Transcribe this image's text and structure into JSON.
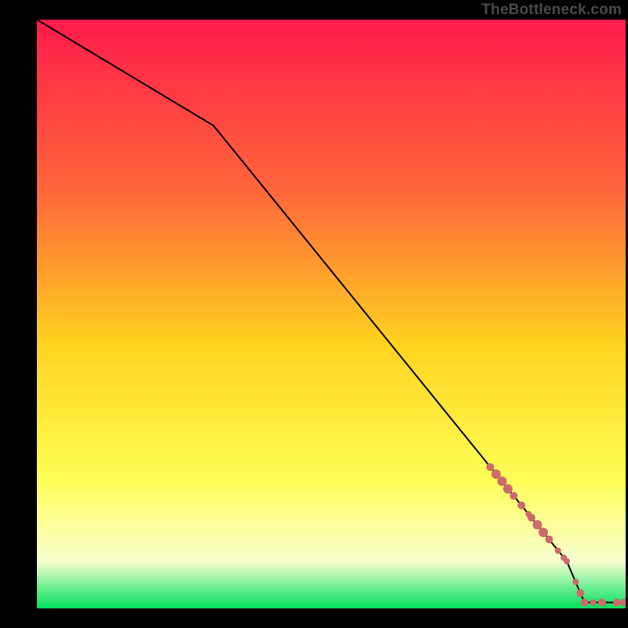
{
  "attribution": "TheBottleneck.com",
  "colors": {
    "frame": "#000000",
    "line": "#000000",
    "point_fill": "#cd6a6a",
    "point_stroke": "#9e4b4b",
    "grad_top": "#ff1a4b",
    "grad_mid1": "#ff6a3a",
    "grad_mid2": "#ffd21f",
    "grad_mid3": "#ffff55",
    "grad_mid4": "#f9ffd0",
    "grad_bottom": "#00e060"
  },
  "chart_data": {
    "type": "line",
    "title": "",
    "xlabel": "",
    "ylabel": "",
    "xlim": [
      0,
      100
    ],
    "ylim": [
      0,
      100
    ],
    "line": {
      "x": [
        0,
        30,
        90,
        93,
        100
      ],
      "y": [
        100,
        82,
        8,
        1,
        1
      ]
    },
    "points": [
      {
        "x": 77.0,
        "y": 24.0,
        "r": 5
      },
      {
        "x": 78.0,
        "y": 22.8,
        "r": 6
      },
      {
        "x": 79.0,
        "y": 21.6,
        "r": 6
      },
      {
        "x": 80.0,
        "y": 20.3,
        "r": 6
      },
      {
        "x": 81.0,
        "y": 19.1,
        "r": 5
      },
      {
        "x": 82.3,
        "y": 17.5,
        "r": 5
      },
      {
        "x": 83.5,
        "y": 16.0,
        "r": 4
      },
      {
        "x": 84.0,
        "y": 15.4,
        "r": 5
      },
      {
        "x": 85.0,
        "y": 14.2,
        "r": 6
      },
      {
        "x": 86.0,
        "y": 12.9,
        "r": 6
      },
      {
        "x": 87.0,
        "y": 11.7,
        "r": 5
      },
      {
        "x": 88.5,
        "y": 9.8,
        "r": 4
      },
      {
        "x": 89.5,
        "y": 8.6,
        "r": 4
      },
      {
        "x": 90.0,
        "y": 8.0,
        "r": 4
      },
      {
        "x": 91.5,
        "y": 4.5,
        "r": 4
      },
      {
        "x": 92.3,
        "y": 2.6,
        "r": 5
      },
      {
        "x": 93.0,
        "y": 1.0,
        "r": 5
      },
      {
        "x": 94.5,
        "y": 1.0,
        "r": 4
      },
      {
        "x": 96.0,
        "y": 1.0,
        "r": 5
      },
      {
        "x": 98.5,
        "y": 1.0,
        "r": 5
      },
      {
        "x": 99.8,
        "y": 1.0,
        "r": 5
      }
    ]
  }
}
